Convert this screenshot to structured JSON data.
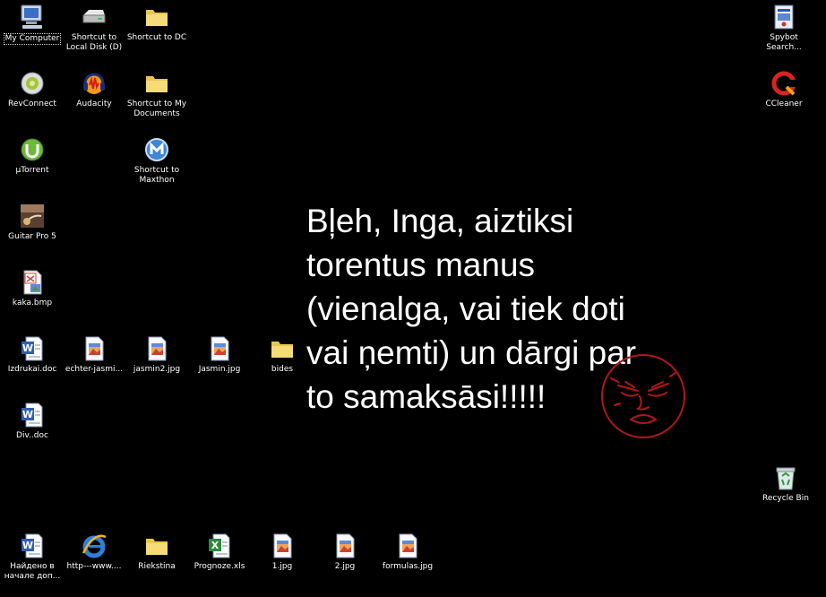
{
  "desktop": {
    "icons": [
      {
        "label": "My Computer",
        "icon": "computer-icon"
      },
      {
        "label": "Shortcut to Local Disk (D)",
        "icon": "drive-icon"
      },
      {
        "label": "Shortcut to DC",
        "icon": "folder-icon"
      },
      {
        "label": "Spybot Search...",
        "icon": "spybot-icon"
      },
      {
        "label": "RevConnect",
        "icon": "revconnect-icon"
      },
      {
        "label": "Audacity",
        "icon": "audacity-icon"
      },
      {
        "label": "Shortcut to My Documents",
        "icon": "folder-icon"
      },
      {
        "label": "CCleaner",
        "icon": "ccleaner-icon"
      },
      {
        "label": "µTorrent",
        "icon": "utorrent-icon"
      },
      {
        "label": "Shortcut to Maxthon",
        "icon": "maxthon-icon"
      },
      {
        "label": "Guitar Pro 5",
        "icon": "guitar-pro-icon"
      },
      {
        "label": "kaka.bmp",
        "icon": "bitmap-file-icon"
      },
      {
        "label": "Izdrukai.doc",
        "icon": "word-doc-icon"
      },
      {
        "label": "echter-jasmi...",
        "icon": "jpg-file-icon"
      },
      {
        "label": "jasmin2.jpg",
        "icon": "jpg-file-icon"
      },
      {
        "label": "Jasmin.jpg",
        "icon": "jpg-file-icon"
      },
      {
        "label": "bides",
        "icon": "folder-icon"
      },
      {
        "label": "Div..doc",
        "icon": "word-doc-icon"
      },
      {
        "label": "Recycle Bin",
        "icon": "recycle-bin-icon"
      },
      {
        "label": "Найдено в начале доп...",
        "icon": "word-doc-icon"
      },
      {
        "label": "http---www....",
        "icon": "internet-explorer-icon"
      },
      {
        "label": "Riekstina",
        "icon": "folder-icon"
      },
      {
        "label": "Prognoze.xls",
        "icon": "excel-file-icon"
      },
      {
        "label": "1.jpg",
        "icon": "jpg-file-icon"
      },
      {
        "label": "2.jpg",
        "icon": "jpg-file-icon"
      },
      {
        "label": "formulas.jpg",
        "icon": "jpg-file-icon"
      }
    ]
  },
  "message": {
    "lines": [
      "Bļeh, Inga, aiztiksi",
      "torentus manus",
      "(vienalga, vai tiek doti",
      "vai ņemti) un dārgi par",
      "to samaksāsi!!!!!"
    ]
  },
  "colors": {
    "background": "#000000",
    "text": "#ffffff",
    "rage_face": "#b01818"
  }
}
